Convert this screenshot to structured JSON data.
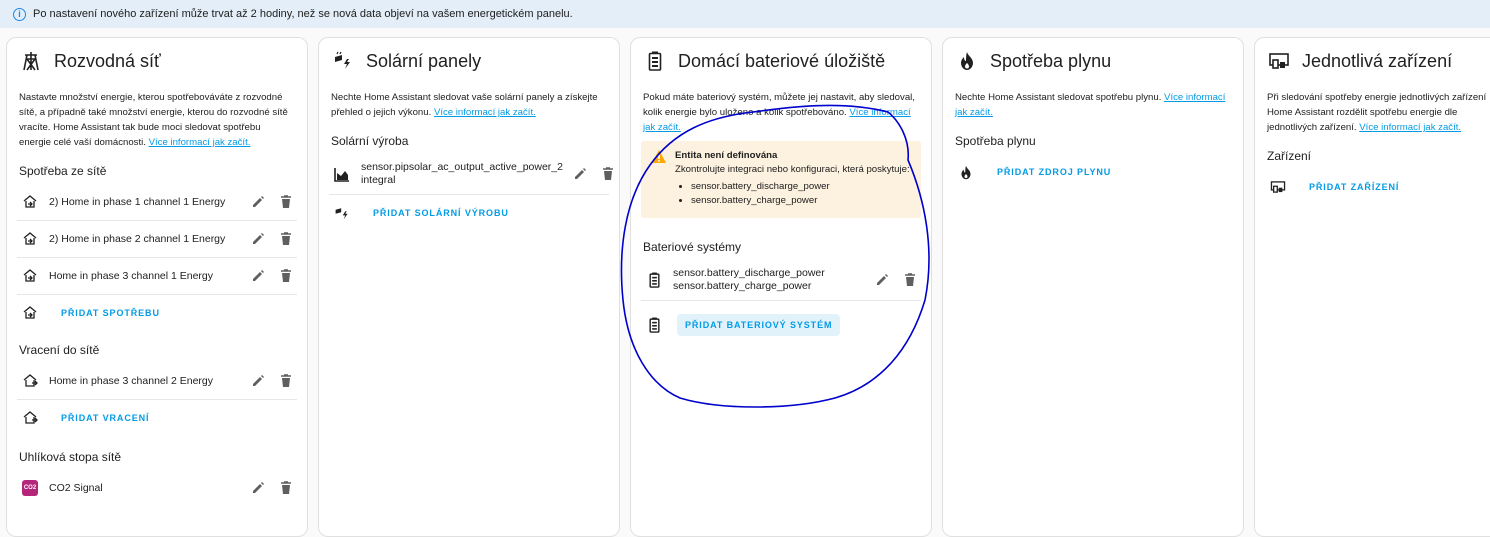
{
  "banner": {
    "text": "Po nastavení nového zařízení může trvat až 2 hodiny, než se nová data objeví na vašem energetickém panelu."
  },
  "colors": {
    "accent": "#039be5",
    "warning": "#ffa600",
    "warning_bg": "#fdf1df",
    "banner_bg": "#e3eef8",
    "annotation": "#0000cc"
  },
  "grid": {
    "title": "Rozvodná síť",
    "icon": "transmission-tower-icon",
    "desc": "Nastavte množství energie, kterou spotřebováváte z rozvodné sítě, a případně také množství energie, kterou do rozvodné sítě vracíte. Home Assistant tak bude moci sledovat spotřebu energie celé vaší domácnosti. ",
    "link": "Více informací jak začít.",
    "consumption_title": "Spotřeba ze sítě",
    "consumption": [
      {
        "label": "2) Home in phase 1 channel 1 Energy"
      },
      {
        "label": "2) Home in phase 2 channel 1 Energy"
      },
      {
        "label": "Home in phase 3 channel 1 Energy"
      }
    ],
    "add_consumption": "PŘIDAT SPOTŘEBU",
    "return_title": "Vracení do sítě",
    "return": [
      {
        "label": "Home in phase 3 channel 2 Energy"
      }
    ],
    "add_return": "PŘIDAT VRACENÍ",
    "co2_title": "Uhlíková stopa sítě",
    "co2": [
      {
        "label": "CO2 Signal",
        "icon_text": "CO2"
      }
    ]
  },
  "solar": {
    "title": "Solární panely",
    "icon": "solar-power-icon",
    "desc": "Nechte Home Assistant sledovat vaše solární panely a získejte přehled o jejich výkonu. ",
    "link": "Více informací jak začít.",
    "production_title": "Solární výroba",
    "production": [
      {
        "label": "sensor.pipsolar_ac_output_active_power_2 integral"
      }
    ],
    "add_production": "PŘIDAT SOLÁRNÍ VÝROBU"
  },
  "battery": {
    "title": "Domácí bateriové úložiště",
    "icon": "battery-icon",
    "desc": "Pokud máte bateriový systém, můžete jej nastavit, aby sledoval, kolik energie bylo uloženo a kolik spotřebováno. ",
    "link": "Více informací jak začít.",
    "warning": {
      "title": "Entita není definována",
      "text": "Zkontrolujte integraci nebo konfiguraci, která poskytuje:",
      "items": [
        "sensor.battery_discharge_power",
        "sensor.battery_charge_power"
      ]
    },
    "systems_title": "Bateriové systémy",
    "system": {
      "line1": "sensor.battery_discharge_power",
      "line2": "sensor.battery_charge_power"
    },
    "add_system": "PŘIDAT BATERIOVÝ SYSTÉM"
  },
  "gas": {
    "title": "Spotřeba plynu",
    "icon": "fire-icon",
    "desc": "Nechte Home Assistant sledovat spotřebu plynu. ",
    "link": "Více informací jak začít.",
    "section_title": "Spotřeba plynu",
    "add_source": "PŘIDAT ZDROJ PLYNU"
  },
  "devices": {
    "title": "Jednotlivá zařízení",
    "icon": "devices-icon",
    "desc": "Při sledování spotřeby energie jednotlivých zařízení Home Assistant rozdělit spotřebu energie dle jednotlivých zařízení. ",
    "link": "Více informací jak začít.",
    "section_title": "Zařízení",
    "add_device": "PŘIDAT ZAŘÍZENÍ"
  }
}
